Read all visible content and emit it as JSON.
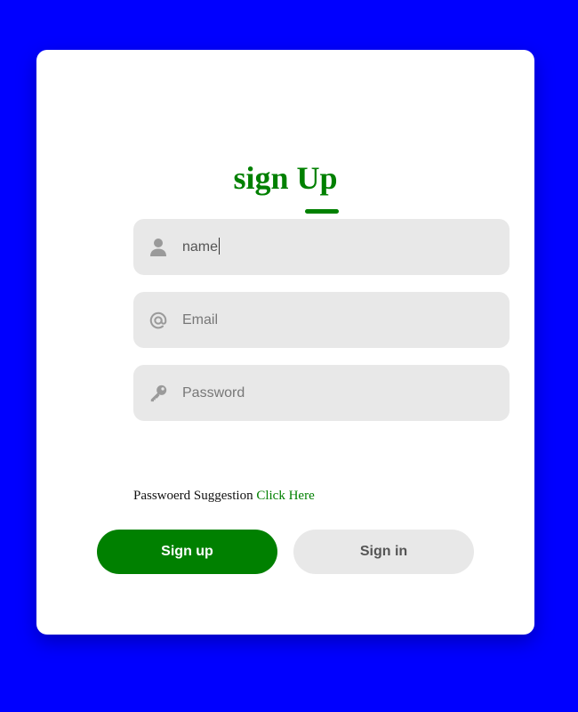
{
  "colors": {
    "background": "#0000ff",
    "card": "#ffffff",
    "accent": "#008000",
    "field": "#e8e8e8",
    "icon": "#9a9a9a"
  },
  "form": {
    "title": "sign Up",
    "fields": [
      {
        "icon": "user-icon",
        "value": "name",
        "placeholder": "name"
      },
      {
        "icon": "at-icon",
        "value": "",
        "placeholder": "Email"
      },
      {
        "icon": "key-icon",
        "value": "",
        "placeholder": "Password"
      }
    ],
    "suggestion_text": "Passwoerd Suggestion",
    "suggestion_link": "Click Here"
  },
  "buttons": {
    "signup_label": "Sign up",
    "signin_label": "Sign in"
  }
}
